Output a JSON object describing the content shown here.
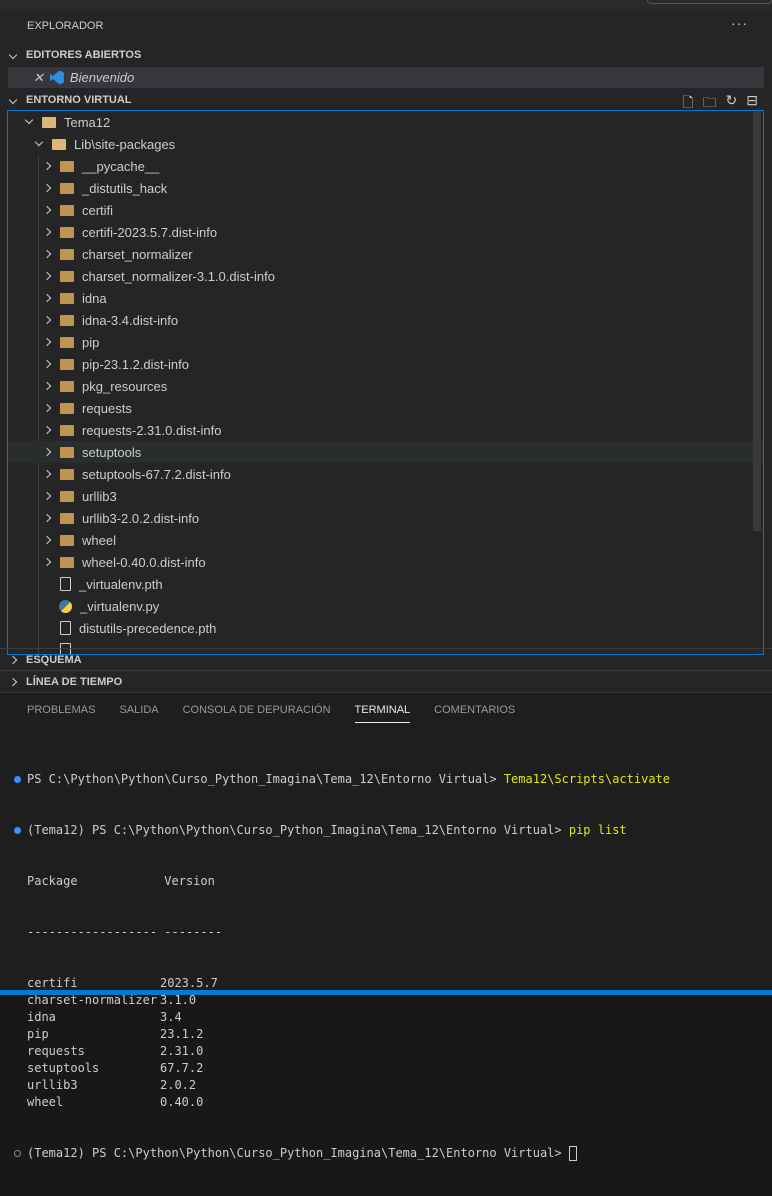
{
  "explorer": {
    "title": "EXPLORADOR",
    "more": "···"
  },
  "open_editors": {
    "title": "EDITORES ABIERTOS",
    "items": [
      {
        "label": "Bienvenido"
      }
    ]
  },
  "workspace": {
    "title": "ENTORNO VIRTUAL",
    "root": "Tema12",
    "sub": "Lib\\site-packages",
    "folders": [
      "__pycache__",
      "_distutils_hack",
      "certifi",
      "certifi-2023.5.7.dist-info",
      "charset_normalizer",
      "charset_normalizer-3.1.0.dist-info",
      "idna",
      "idna-3.4.dist-info",
      "pip",
      "pip-23.1.2.dist-info",
      "pkg_resources",
      "requests",
      "requests-2.31.0.dist-info",
      "setuptools",
      "setuptools-67.7.2.dist-info",
      "urllib3",
      "urllib3-2.0.2.dist-info",
      "wheel",
      "wheel-0.40.0.dist-info"
    ],
    "files": [
      {
        "label": "_virtualenv.pth",
        "type": "file"
      },
      {
        "label": "_virtualenv.py",
        "type": "python"
      },
      {
        "label": "distutils-precedence.pth",
        "type": "file"
      }
    ],
    "hovered": "setuptools"
  },
  "sections": {
    "outline": "ESQUEMA",
    "timeline": "LÍNEA DE TIEMPO"
  },
  "panel": {
    "tabs": [
      "PROBLEMAS",
      "SALIDA",
      "CONSOLA DE DEPURACIÓN",
      "TERMINAL",
      "COMENTARIOS"
    ],
    "active": "TERMINAL"
  },
  "terminal": {
    "line1_prompt": "PS C:\\Python\\Python\\Curso_Python_Imagina\\Tema_12\\Entorno Virtual> ",
    "line1_cmd": "Tema12\\Scripts\\activate",
    "line2_prompt": "(Tema12) PS C:\\Python\\Python\\Curso_Python_Imagina\\Tema_12\\Entorno Virtual> ",
    "line2_cmd": "pip list",
    "header": "Package            Version",
    "sep": "------------------ --------",
    "packages": [
      [
        "certifi",
        "2023.5.7"
      ],
      [
        "charset-normalizer",
        "3.1.0"
      ],
      [
        "idna",
        "3.4"
      ],
      [
        "pip",
        "23.1.2"
      ],
      [
        "requests",
        "2.31.0"
      ],
      [
        "setuptools",
        "67.7.2"
      ],
      [
        "urllib3",
        "2.0.2"
      ],
      [
        "wheel",
        "0.40.0"
      ]
    ],
    "last_prompt": "(Tema12) PS C:\\Python\\Python\\Curso_Python_Imagina\\Tema_12\\Entorno Virtual> "
  },
  "colors": {
    "accent": "#0078d4",
    "folder": "#c09553",
    "command": "#e5e510",
    "status_bar": "#007acc"
  }
}
